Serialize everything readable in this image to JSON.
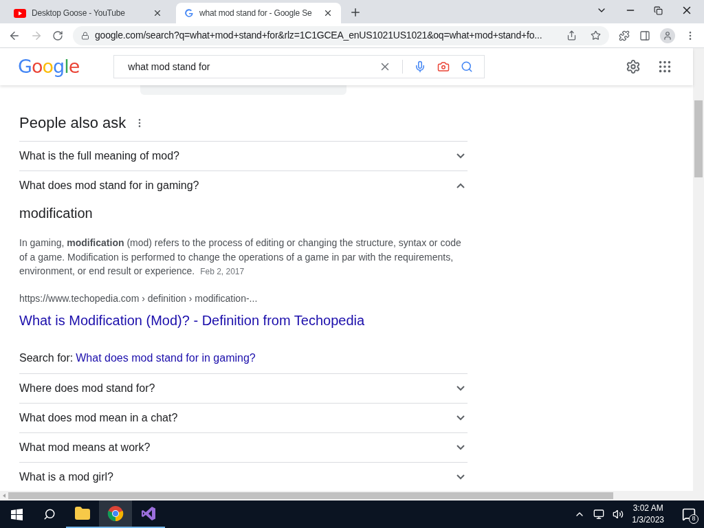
{
  "tabs": [
    {
      "title": "Desktop Goose - YouTube",
      "kind": "youtube",
      "selected": false
    },
    {
      "title": "what mod stand for - Google Se",
      "kind": "google",
      "selected": true
    }
  ],
  "address_bar": {
    "url": "google.com/search?q=what+mod+stand+for&rlz=1C1GCEA_enUS1021US1021&oq=what+mod+stand+fo..."
  },
  "search_header": {
    "logo": "Google",
    "query": "what mod stand for"
  },
  "people_also_ask": {
    "title": "People also ask",
    "questions": [
      {
        "text": "What is the full meaning of mod?",
        "expanded": false
      },
      {
        "text": "What does mod stand for in gaming?",
        "expanded": true,
        "answer": {
          "heading": "modification",
          "paragraph": "In gaming, **modification** (mod) refers to the process of editing or changing the structure, syntax or code of a game. Modification is performed to change the operations of a game in par with the requirements, environment, or end result or experience.",
          "date": "Feb 2, 2017",
          "source": "https://www.techopedia.com › definition › modification-...",
          "link": "What is Modification (Mod)? - Definition from Techopedia",
          "search_for_label": "Search for:",
          "search_for_link": "What does mod stand for in gaming?"
        }
      },
      {
        "text": "Where does mod stand for?",
        "expanded": false
      },
      {
        "text": "What does mod mean in a chat?",
        "expanded": false
      },
      {
        "text": "What mod means at work?",
        "expanded": false
      },
      {
        "text": "What is a mod girl?",
        "expanded": false
      }
    ]
  },
  "taskbar": {
    "apps": [
      {
        "kind": "explorer",
        "selected": false
      },
      {
        "kind": "chrome",
        "selected": true
      },
      {
        "kind": "vs",
        "selected": false
      }
    ],
    "time": "3:02 AM",
    "date": "1/3/2023",
    "notifications": "8"
  }
}
